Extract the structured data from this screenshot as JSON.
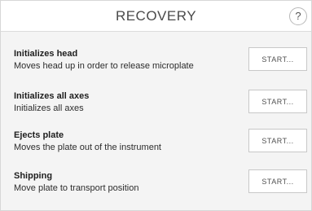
{
  "header": {
    "title": "RECOVERY",
    "help_label": "?"
  },
  "rows": [
    {
      "title": "Initializes head",
      "description": "Moves head up in order to release microplate",
      "button_label": "START..."
    },
    {
      "title": "Initializes all axes",
      "description": "Initializes all axes",
      "button_label": "START..."
    },
    {
      "title": "Ejects plate",
      "description": "Moves the plate out of the instrument",
      "button_label": "START..."
    },
    {
      "title": "Shipping",
      "description": "Move plate to transport position",
      "button_label": "START..."
    }
  ]
}
